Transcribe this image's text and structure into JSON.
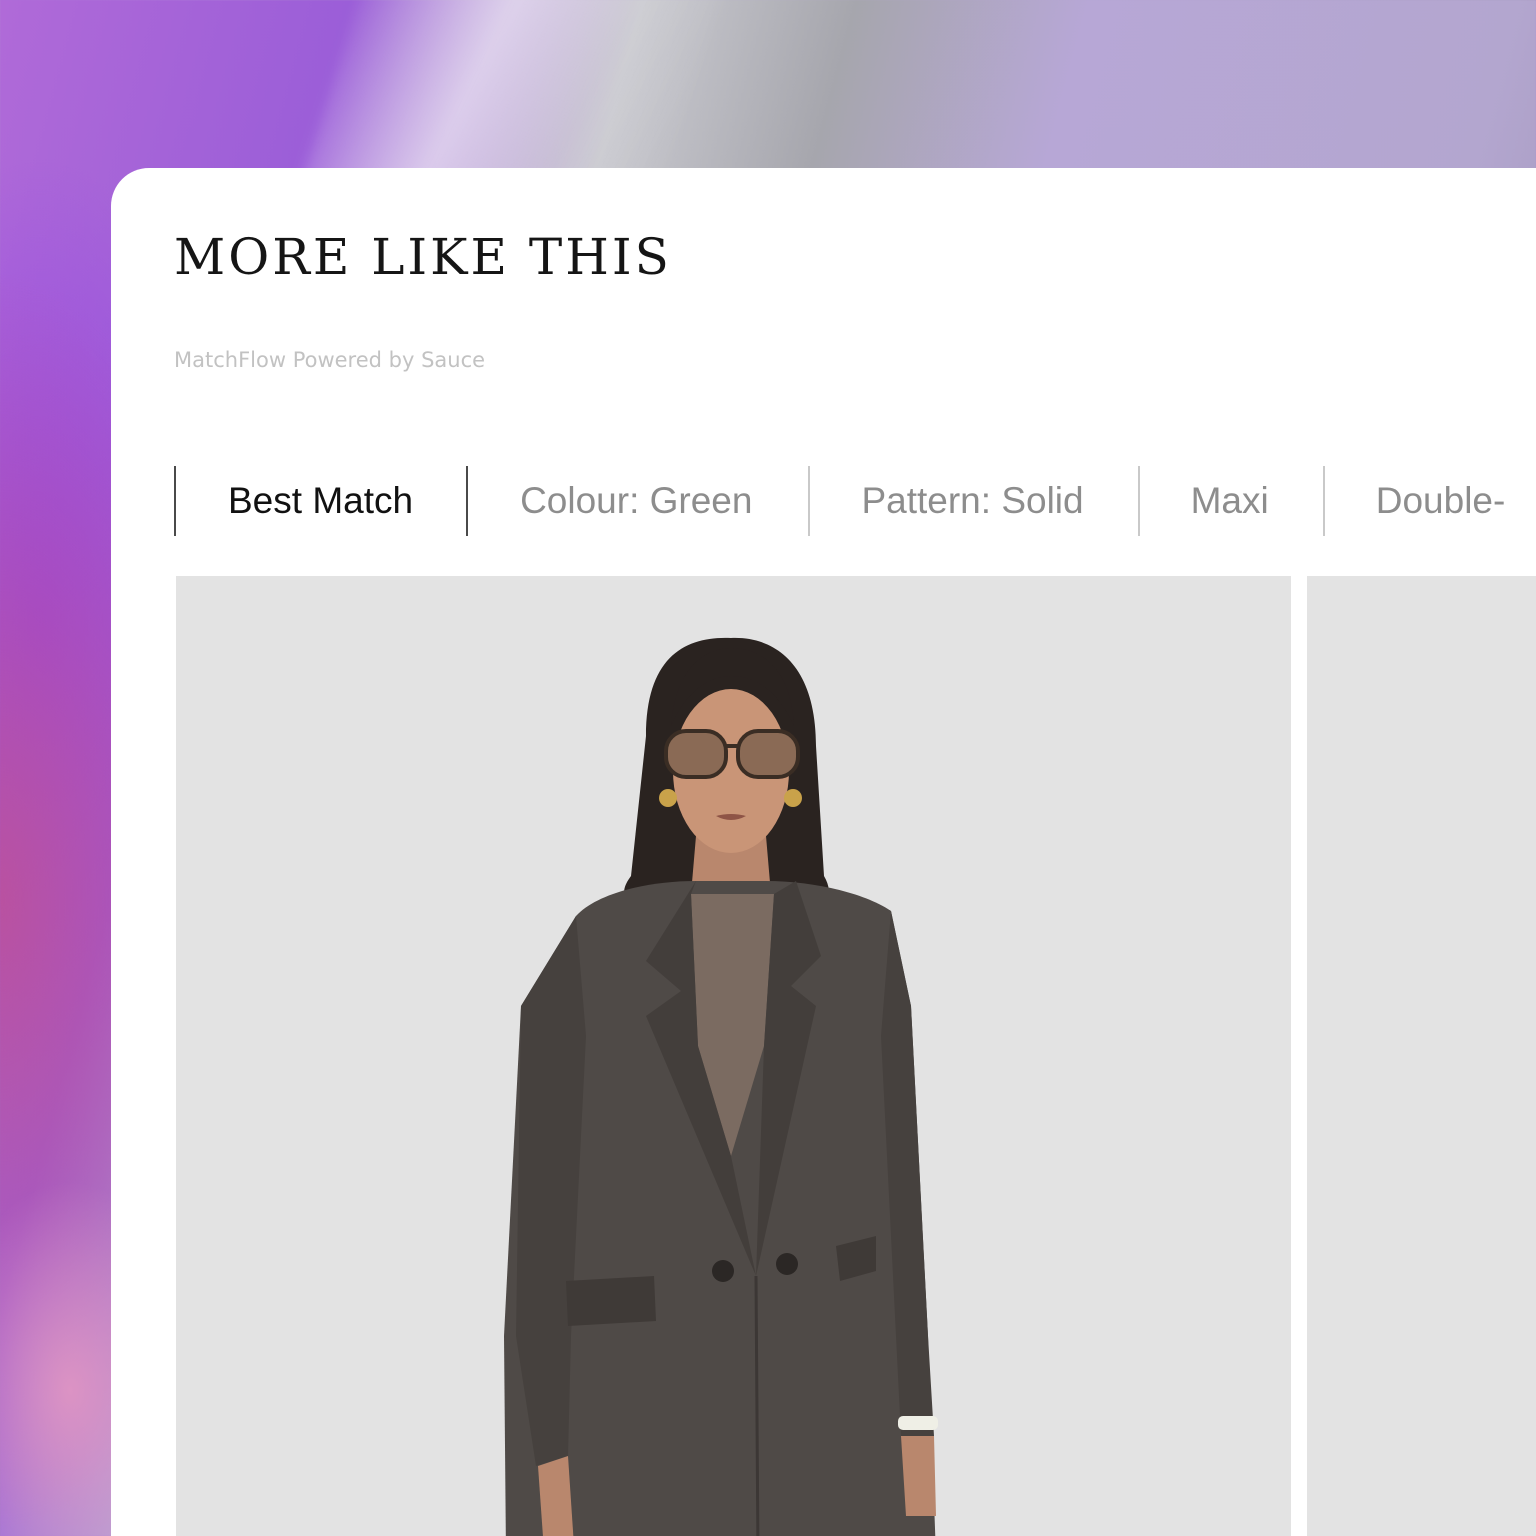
{
  "section": {
    "title": "MORE LIKE THIS",
    "powered_by": "MatchFlow Powered by Sauce"
  },
  "filters": [
    {
      "label": "Best Match",
      "active": true
    },
    {
      "label": "Colour: Green",
      "active": false
    },
    {
      "label": "Pattern: Solid",
      "active": false
    },
    {
      "label": "Maxi",
      "active": false
    },
    {
      "label": "Double-",
      "active": false
    }
  ],
  "colors": {
    "panel_background": "#ffffff",
    "card_background": "#e3e3e3",
    "active_filter_text": "#111111",
    "inactive_filter_text": "#8d8d8d",
    "coat": "#4f4a47"
  },
  "products": [
    {
      "image": "model-in-dark-grey-double-breasted-coat-with-sunglasses"
    },
    {
      "image": "partially-visible-product-image"
    }
  ]
}
